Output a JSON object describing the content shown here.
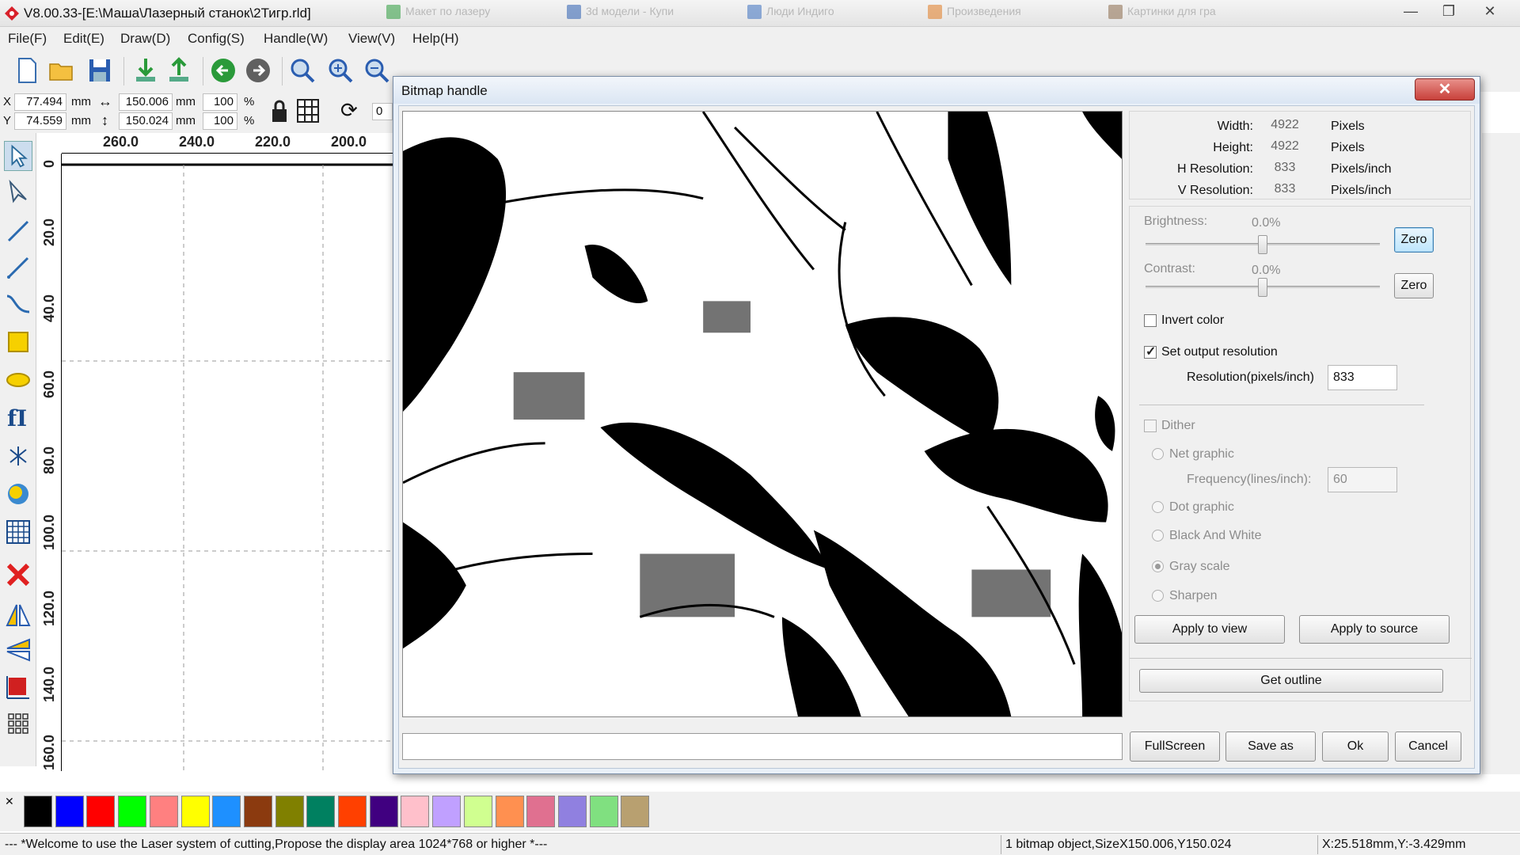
{
  "window": {
    "title": "V8.00.33-[E:\\Маша\\Лазерный станок\\2Тигр.rld]",
    "bg_tabs": [
      "Макет по лазеру",
      "3d модели - Купи",
      "Люди Индиго",
      "Произведения",
      "Картинки для гра"
    ],
    "controls": {
      "minimize": "—",
      "maximize": "❐",
      "close": "✕"
    }
  },
  "menu": [
    "File(F)",
    "Edit(E)",
    "Draw(D)",
    "Config(S)",
    "Handle(W)",
    "View(V)",
    "Help(H)"
  ],
  "propbar": {
    "x_label": "X",
    "x_value": "77.494",
    "x_unit": "mm",
    "y_label": "Y",
    "y_value": "74.559",
    "y_unit": "mm",
    "w_value": "150.006",
    "w_unit": "mm",
    "h_value": "150.024",
    "h_unit": "mm",
    "sx_value": "100",
    "sy_value": "100",
    "pct": "%",
    "rotate_value": "0"
  },
  "ruler": {
    "h_labels": [
      "260.0",
      "240.0",
      "220.0",
      "200.0"
    ],
    "v_labels": [
      "0",
      "20.0",
      "40.0",
      "60.0",
      "80.0",
      "100.0",
      "120.0",
      "140.0",
      "160.0"
    ]
  },
  "palette": [
    "#000000",
    "#0000ff",
    "#ff0000",
    "#00ff00",
    "#ff8080",
    "#ffff00",
    "#1e90ff",
    "#8b3a0f",
    "#808000",
    "#008060",
    "#ff4000",
    "#400080",
    "#ffc0cb",
    "#c0a0ff",
    "#d0ff90",
    "#ff9050",
    "#e07090",
    "#9080e0",
    "#80e080",
    "#b8a070"
  ],
  "status": {
    "welcome": "--- *Welcome to use the Laser system of cutting,Propose the display area 1024*768 or higher *---",
    "selection": "1 bitmap object,SizeX150.006,Y150.024",
    "cursor": "X:25.518mm,Y:-3.429mm"
  },
  "dialog": {
    "title": "Bitmap handle",
    "close": "✕",
    "info": {
      "width_label": "Width:",
      "width_value": "4922",
      "width_unit": "Pixels",
      "height_label": "Height:",
      "height_value": "4922",
      "height_unit": "Pixels",
      "hres_label": "H Resolution:",
      "hres_value": "833",
      "hres_unit": "Pixels/inch",
      "vres_label": "V Resolution:",
      "vres_value": "833",
      "vres_unit": "Pixels/inch"
    },
    "brightness": {
      "label": "Brightness:",
      "value": "0.0%",
      "zero": "Zero"
    },
    "contrast": {
      "label": "Contrast:",
      "value": "0.0%",
      "zero": "Zero"
    },
    "invert_color": {
      "label": "Invert color",
      "checked": false
    },
    "set_output_resolution": {
      "label": "Set output resolution",
      "checked": true
    },
    "resolution": {
      "label": "Resolution(pixels/inch)",
      "value": "833"
    },
    "dither": {
      "label": "Dither",
      "checked": false
    },
    "net_graphic": "Net graphic",
    "frequency": {
      "label": "Frequency(lines/inch):",
      "value": "60"
    },
    "dot_graphic": "Dot graphic",
    "black_and_white": "Black And White",
    "gray_scale": "Gray scale",
    "sharpen": "Sharpen",
    "selected_mode": "Gray scale",
    "apply_to_view": "Apply to view",
    "apply_to_source": "Apply to source",
    "get_outline": "Get outline",
    "fullscreen": "FullScreen",
    "save_as": "Save as",
    "ok": "Ok",
    "cancel": "Cancel"
  }
}
